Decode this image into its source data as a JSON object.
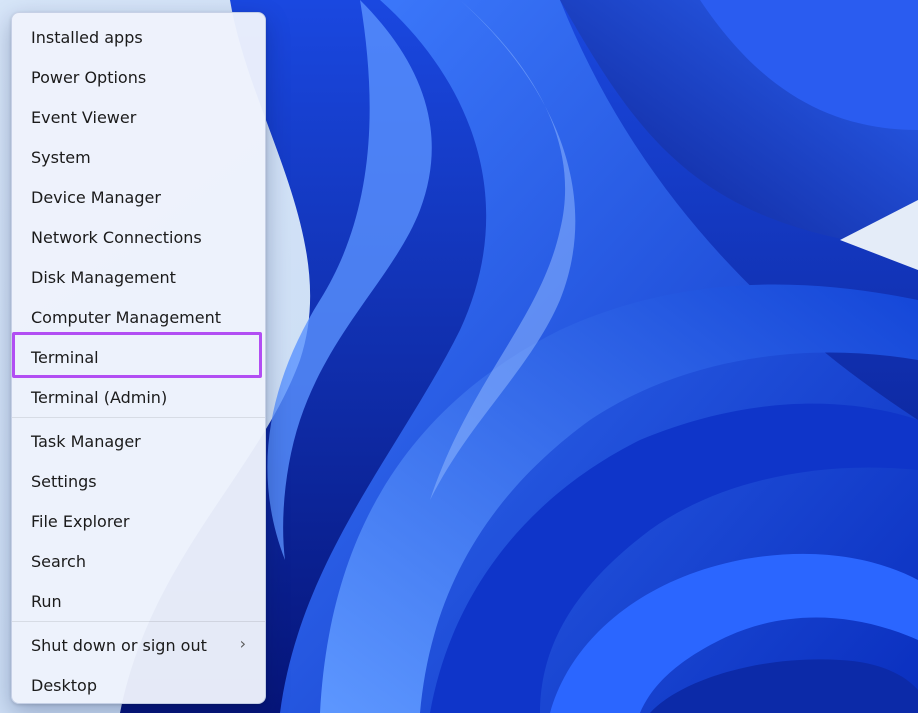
{
  "wallpaper": {
    "name": "Windows 11 bloom wallpaper",
    "accent": "#1f5fe8"
  },
  "menu": {
    "group1": [
      "Installed apps",
      "Power Options",
      "Event Viewer",
      "System",
      "Device Manager",
      "Network Connections",
      "Disk Management",
      "Computer Management",
      "Terminal",
      "Terminal (Admin)"
    ],
    "group2": [
      "Task Manager",
      "Settings",
      "File Explorer",
      "Search",
      "Run"
    ],
    "group3": [
      {
        "label": "Shut down or sign out",
        "has_submenu": true,
        "submenu_icon": "chevron-right-icon"
      },
      {
        "label": "Desktop",
        "has_submenu": false
      }
    ],
    "highlighted_item": "Terminal",
    "highlight_color": "#b24ef3"
  }
}
